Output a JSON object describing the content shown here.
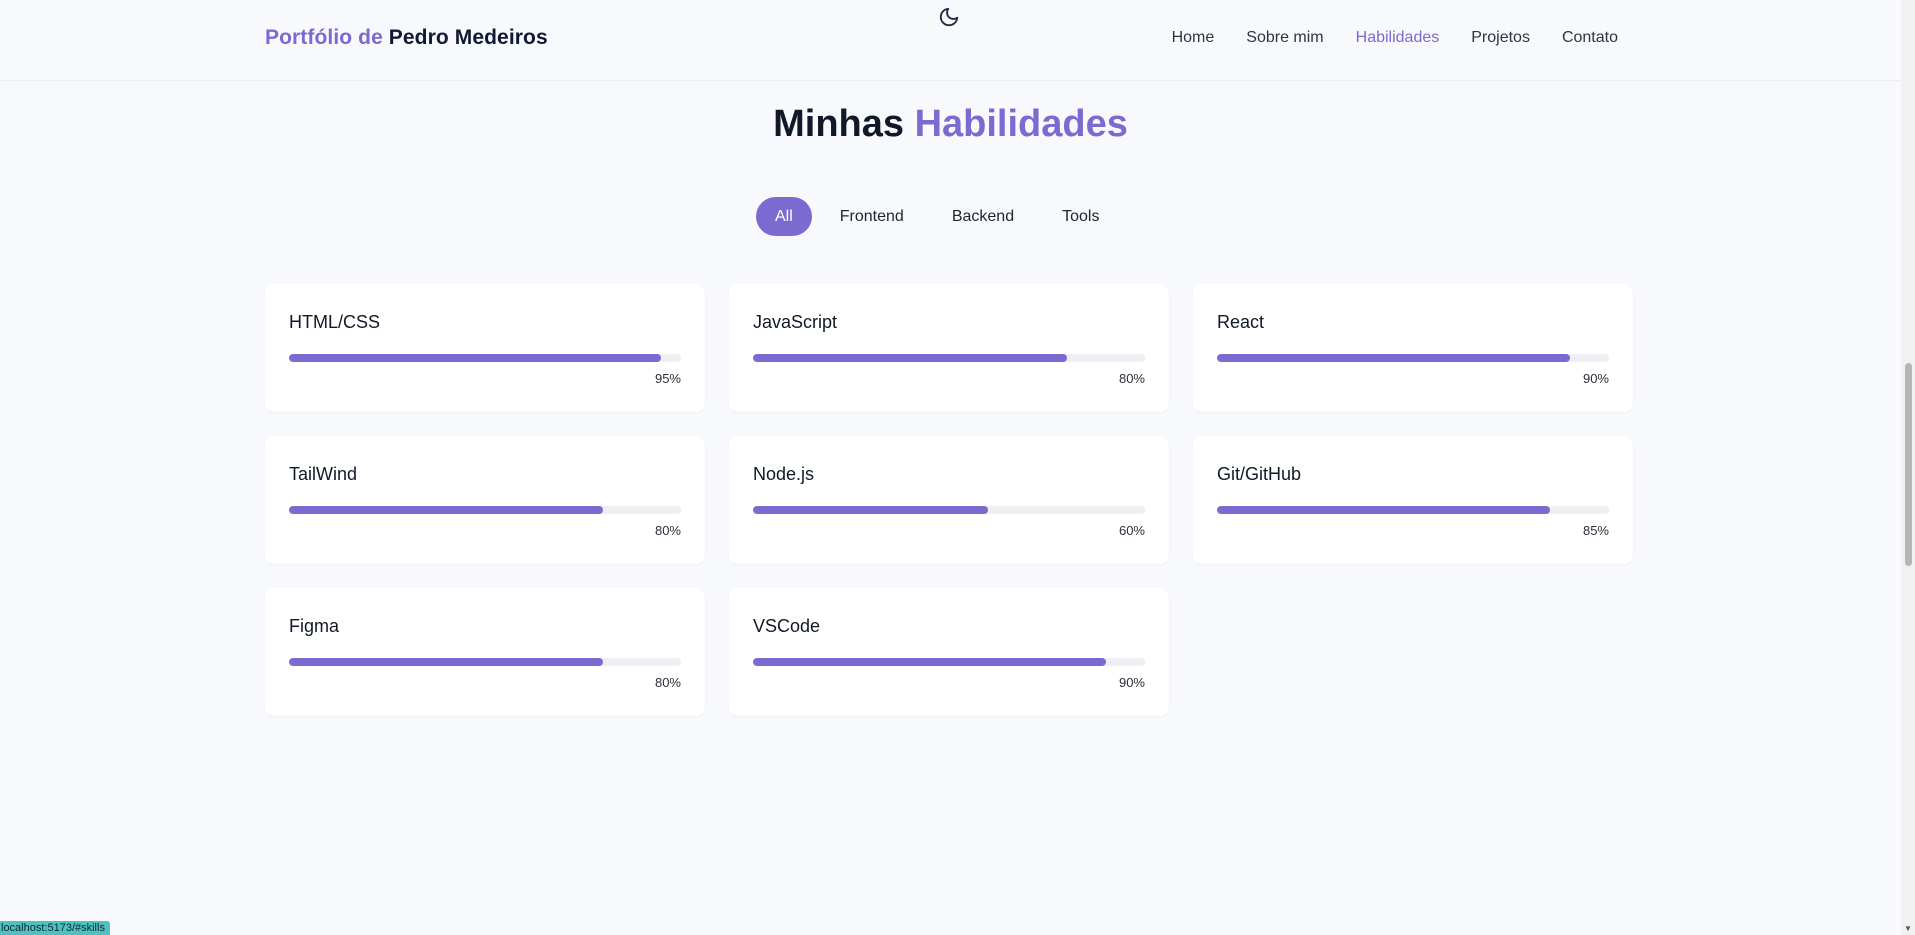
{
  "nav": {
    "brand_prefix": "Portfólio de",
    "brand_name": "Pedro Medeiros",
    "links": [
      {
        "label": "Home"
      },
      {
        "label": "Sobre mim"
      },
      {
        "label": "Habilidades"
      },
      {
        "label": "Projetos"
      },
      {
        "label": "Contato"
      }
    ],
    "active_link": "Habilidades",
    "theme_icon": "moon-icon"
  },
  "section": {
    "title_prefix": "Minhas",
    "title_accent": "Habilidades"
  },
  "filters": {
    "items": [
      {
        "label": "All"
      },
      {
        "label": "Frontend"
      },
      {
        "label": "Backend"
      },
      {
        "label": "Tools"
      }
    ],
    "active": "All"
  },
  "skills": [
    {
      "name": "HTML/CSS",
      "level": 95,
      "level_label": "95%"
    },
    {
      "name": "JavaScript",
      "level": 80,
      "level_label": "80%"
    },
    {
      "name": "React",
      "level": 90,
      "level_label": "90%"
    },
    {
      "name": "TailWind",
      "level": 80,
      "level_label": "80%"
    },
    {
      "name": "Node.js",
      "level": 60,
      "level_label": "60%"
    },
    {
      "name": "Git/GitHub",
      "level": 85,
      "level_label": "85%"
    },
    {
      "name": "Figma",
      "level": 80,
      "level_label": "80%"
    },
    {
      "name": "VSCode",
      "level": 90,
      "level_label": "90%"
    }
  ],
  "status_url": "localhost:5173/#skills",
  "colors": {
    "accent": "#7c6ad0",
    "background": "#f8f9fc",
    "card": "#ffffff",
    "heading": "#111827"
  }
}
